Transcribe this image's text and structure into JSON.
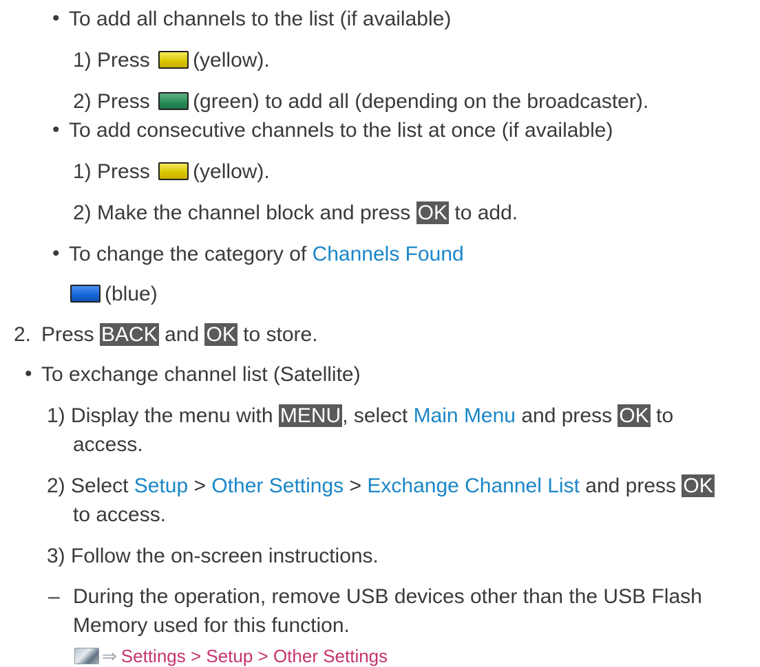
{
  "bullets": {
    "glyph": "•",
    "dash": "–"
  },
  "add_all": {
    "heading": "To add all channels to the list (if available)",
    "step1": {
      "num": "1)",
      "pre": "Press",
      "color": "(yellow)."
    },
    "step2": {
      "num": "2)",
      "pre": "Press",
      "post": "(green) to add all (depending on the broadcaster)."
    }
  },
  "add_consecutive": {
    "heading": "To add consecutive channels to the list at once (if available)",
    "step1": {
      "num": "1)",
      "pre": "Press",
      "color": "(yellow)."
    },
    "step2": {
      "num": "2)",
      "pre": "Make the channel block and press",
      "key": "OK",
      "post": "to add."
    }
  },
  "change_category": {
    "pre": "To change the category of",
    "link": "Channels Found",
    "blue": "(blue)"
  },
  "store": {
    "num": "2.",
    "pre": "Press",
    "key_back": "BACK",
    "mid": "and",
    "key_ok": "OK",
    "post": "to store."
  },
  "exchange": {
    "heading": "To exchange channel list (Satellite)",
    "step1": {
      "num": "1)",
      "pre": "Display the menu with",
      "key_menu": "MENU",
      "mid1": ", select",
      "link": "Main Menu",
      "mid2": "and press",
      "key_ok": "OK",
      "post": "to",
      "cont": "access."
    },
    "step2": {
      "num": "2)",
      "pre": "Select",
      "link1": "Setup",
      "sep1": ">",
      "link2": "Other Settings",
      "sep2": ">",
      "link3": "Exchange Channel List",
      "mid": "and press",
      "key_ok": "OK",
      "cont": "to access."
    },
    "step3": {
      "num": "3)",
      "text": "Follow the on-screen instructions."
    },
    "note": {
      "line1": "During the operation, remove USB devices other than the USB Flash",
      "line2": "Memory used for this function."
    },
    "nav": {
      "icon": "navigation-menu-icon",
      "arrow": "⇒",
      "path": "Settings > Setup > Other Settings"
    }
  },
  "colors": {
    "link_blue": "#1a86c8",
    "link_pink": "#c4336d",
    "key_bg": "#5a5a5a",
    "yellow_button": "#d9c400",
    "green_button": "#2a8a58",
    "blue_button": "#1565d6"
  }
}
